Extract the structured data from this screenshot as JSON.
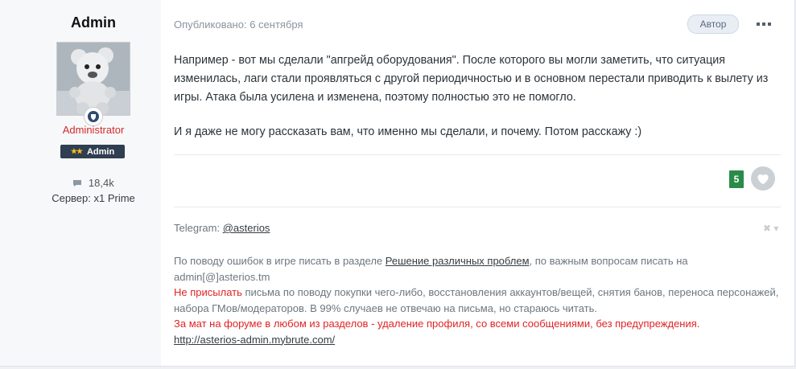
{
  "author": {
    "name": "Admin",
    "group": "Administrator",
    "badge_label": "Admin",
    "badge_stars": "★★",
    "posts": "18,4k",
    "server": "Сервер: x1 Prime"
  },
  "post": {
    "published": "Опубликовано: 6 сентября",
    "author_tag": "Автор",
    "paragraph1": "Например - вот мы сделали \"апгрейд оборудования\". После которого вы могли заметить, что ситуация изменилась, лаги стали проявляться с другой периодичностью и в основном перестали приводить к вылету из игры. Атака была усилена и изменена, поэтому полностью это не помогло.",
    "paragraph2": "И я даже не могу рассказать вам, что именно мы сделали, и почему. Потом расскажу :)",
    "reputation": "5"
  },
  "signature": {
    "telegram_label": "Telegram: ",
    "telegram_link": "@asterios",
    "close_glyph": "✖ ▾",
    "line1_pre": "По поводу ошибок в игре писать в разделе ",
    "line1_link": "Решение различных проблем",
    "line1_post": ", по важным вопросам писать на admin[@]asterios.tm",
    "line2_red": "Не присылать",
    "line2_rest": " письма по поводу покупки чего-либо, восстановления аккаунтов/вещей, снятия банов, переноса персонажей, набора ГМов/модераторов. В 99% случаев не отвечаю на письма, но стараюсь читать.",
    "line3_red": "За мат на форуме в любом из разделов - удаление профиля, со всеми сообщениями, без предупреждения.",
    "line4_link": "http://asterios-admin.mybrute.com/"
  },
  "icons": {
    "more": "more-options-icon",
    "like": "heart-icon",
    "posts": "comment-bubble-icon",
    "rank": "shield-rank-icon"
  },
  "colors": {
    "group_red": "#d32a2a",
    "reputation_green": "#2a8b49",
    "badge_bg": "#2f3e50",
    "warning_red": "#e02424"
  }
}
